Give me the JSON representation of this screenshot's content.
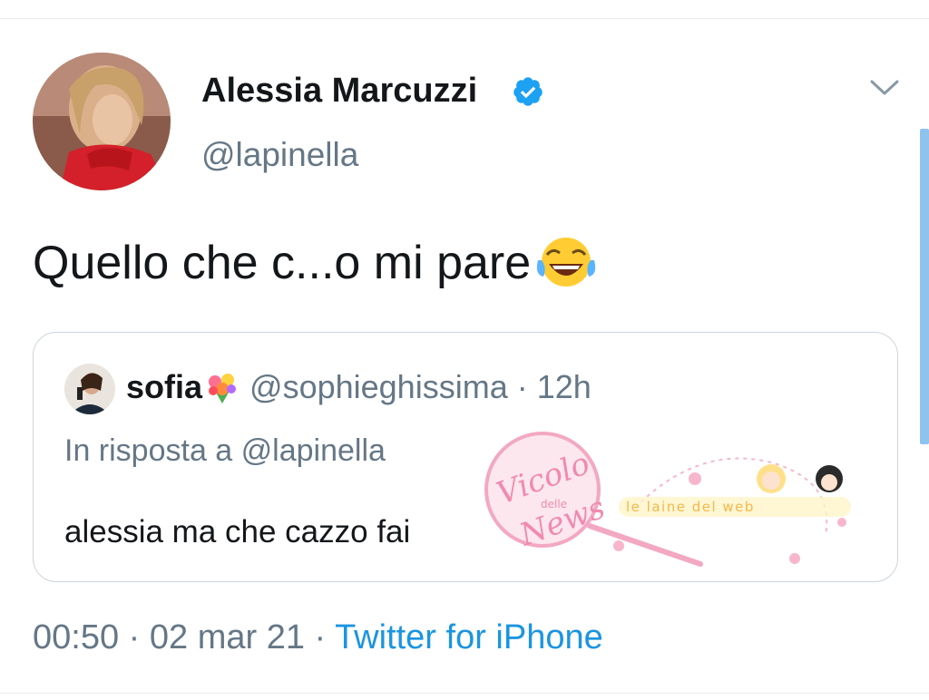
{
  "author": {
    "display_name": "Alessia Marcuzzi",
    "handle": "@lapinella",
    "verified": true
  },
  "tweet": {
    "text": "Quello che c...o mi pare",
    "emoji": "face-with-tears-of-joy"
  },
  "quoted_tweet": {
    "name": "sofia",
    "name_emoji": "bouquet",
    "handle": "@sophieghissima",
    "separator": "·",
    "time": "12h",
    "reply_to": "In risposta a @lapinella",
    "text": "alessia ma che cazzo fai"
  },
  "meta": {
    "time": "00:50",
    "date": "02 mar 21",
    "separator": "·",
    "source": "Twitter for iPhone"
  },
  "watermark": {
    "line1": "Vicolo",
    "line2": "delle",
    "line3": "News",
    "banner": "le laine del web"
  },
  "colors": {
    "accent": "#1b95e0",
    "verified": "#1da1f2",
    "secondary_text": "#657786",
    "border": "#ccd6dd"
  }
}
